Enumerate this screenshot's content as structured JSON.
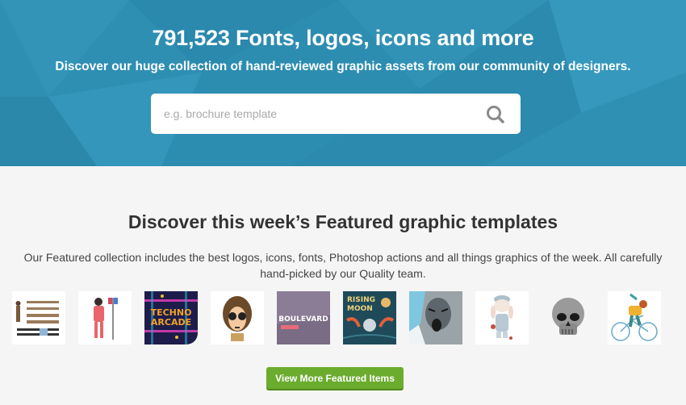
{
  "hero": {
    "title": "791,523 Fonts, logos, icons and more",
    "subtitle": "Discover our huge collection of hand-reviewed graphic assets from our community of designers.",
    "search": {
      "placeholder": "e.g. brochure template",
      "value": "",
      "icon": "search-icon"
    }
  },
  "featured": {
    "title": "Discover this week’s Featured graphic templates",
    "description": "Our Featured collection includes the best logos, icons, fonts, Photoshop actions and all things graphics of the week. All carefully hand-picked by our Quality team.",
    "items": [
      {
        "name": "character-creation-kit",
        "label": ""
      },
      {
        "name": "nurse-illustration",
        "label": ""
      },
      {
        "name": "techno-arcade",
        "label": "TECHNO ARCADE"
      },
      {
        "name": "woman-sunglasses-illustration",
        "label": ""
      },
      {
        "name": "boulevard-template",
        "label": "BOULEVARD"
      },
      {
        "name": "rising-moon-poster",
        "label": "RISING MOON"
      },
      {
        "name": "screaming-face-art",
        "label": ""
      },
      {
        "name": "bunny-character",
        "label": ""
      },
      {
        "name": "skull-illustration",
        "label": ""
      },
      {
        "name": "cyclist-illustration",
        "label": ""
      }
    ],
    "cta_label": "View More Featured Items"
  },
  "colors": {
    "hero_bg": "#2e8fb3",
    "cta_green": "#6bab2e",
    "page_bg": "#f5f5f5"
  }
}
